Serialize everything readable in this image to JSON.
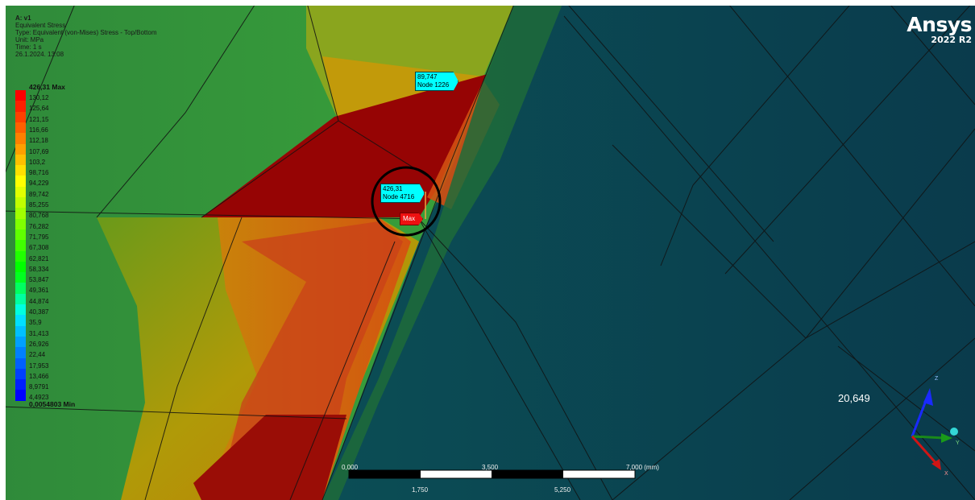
{
  "header": {
    "title": "A: v1",
    "result": "Equivalent Stress",
    "type": "Type: Equivalent (von-Mises) Stress - Top/Bottom",
    "unit": "Unit: MPa",
    "time": "Time: 1 s",
    "date": "26.1.2024. 13:08"
  },
  "legend": {
    "max_label": "426,31 Max",
    "min_label": "0,0054803 Min",
    "levels": [
      "130,12",
      "125,64",
      "121,15",
      "116,66",
      "112,18",
      "107,69",
      "103,2",
      "98,716",
      "94,229",
      "89,742",
      "85,255",
      "80,768",
      "76,282",
      "71,795",
      "67,308",
      "62,821",
      "58,334",
      "53,847",
      "49,361",
      "44,874",
      "40,387",
      "35,9",
      "31,413",
      "26,926",
      "22,44",
      "17,953",
      "13,466",
      "8,9791",
      "4,4923"
    ],
    "colors": [
      "#ff0000",
      "#ff2000",
      "#ff4000",
      "#ff6000",
      "#ff8000",
      "#ffa000",
      "#ffc000",
      "#ffe000",
      "#ffff00",
      "#e0ff00",
      "#c0ff00",
      "#a0ff00",
      "#80ff00",
      "#60ff00",
      "#40ff00",
      "#20ff00",
      "#00ff00",
      "#00ff20",
      "#00ff60",
      "#00ffa0",
      "#00ffe0",
      "#00e0ff",
      "#00c0ff",
      "#00a0ff",
      "#0080ff",
      "#0060ff",
      "#0040ff",
      "#0020ff",
      "#0000ff"
    ]
  },
  "brand": {
    "name": "Ansys",
    "version": "2022 R2"
  },
  "probes": [
    {
      "value": "89,747",
      "node": "Node 1226"
    },
    {
      "value": "426,31",
      "node": "Node 4716"
    }
  ],
  "max_tag": "Max",
  "min_annotation": "20,649",
  "scale_bar": {
    "top_labels": [
      "0,000",
      "3,500",
      "7,000 (mm)"
    ],
    "bottom_labels": [
      "1,750",
      "5,250"
    ]
  },
  "triad": {
    "z": "Z",
    "y": "Y",
    "x": "X"
  }
}
